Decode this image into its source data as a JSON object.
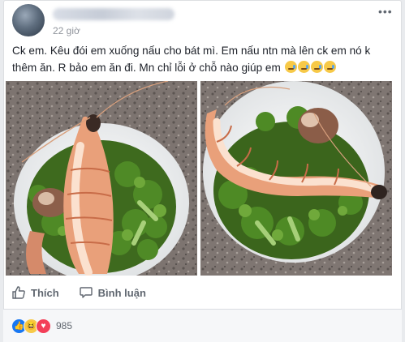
{
  "post": {
    "time": "22 giờ",
    "caption": "Ck em. Kêu đói em xuống nấu cho bát mì. Em nấu ntn mà lên ck em nó k thêm ăn. R bảo em ăn đi. Mn chỉ lỗi ở chỗ nào giúp em",
    "caption_emoji": [
      "sad-tear-emoji",
      "sad-tear-emoji",
      "sad-tear-emoji",
      "sad-tear-emoji"
    ],
    "photos": [
      "shrimp-broccoli-photo",
      "shrimp-broccoli-photo"
    ]
  },
  "actions": {
    "like_label": "Thích",
    "comment_label": "Bình luận"
  },
  "reactions": {
    "icons": [
      "like",
      "haha",
      "love"
    ],
    "count": "985"
  },
  "colors": {
    "facebook_blue": "#1877f2",
    "love_red": "#f33e58",
    "haha_yellow": "#f7c948"
  }
}
